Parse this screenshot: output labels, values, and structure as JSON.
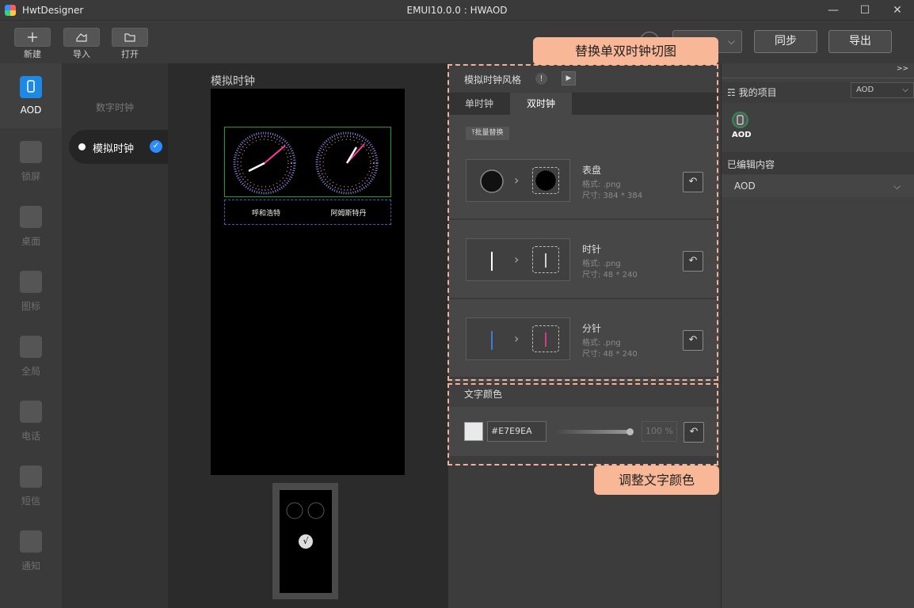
{
  "window": {
    "app_name": "HwtDesigner",
    "title": "EMUI10.0.0 : HWAOD",
    "minimize": "—",
    "maximize": "☐",
    "close": "✕"
  },
  "toolbar": {
    "new_label": "新建",
    "import_label": "导入",
    "open_label": "打开",
    "sync_label": "同步",
    "export_label": "导出",
    "version_value": ""
  },
  "leftnav": {
    "items": [
      {
        "label": "AOD",
        "icon": "phone-icon"
      },
      {
        "label": "锁屏",
        "icon": "lock-screen-icon"
      },
      {
        "label": "桌面",
        "icon": "desktop-icon"
      },
      {
        "label": "图标",
        "icon": "grid-icon"
      },
      {
        "label": "全局",
        "icon": "gear-icon"
      },
      {
        "label": "电话",
        "icon": "phone-call-icon"
      },
      {
        "label": "短信",
        "icon": "message-icon"
      },
      {
        "label": "通知",
        "icon": "notification-icon"
      }
    ]
  },
  "subnav": {
    "digital": "数字时钟",
    "analog": "模拟时钟",
    "check": "✓"
  },
  "canvas": {
    "title": "模拟时钟",
    "city_left": "呼和浩特",
    "city_right": "阿姆斯特丹",
    "thumb_check": "√"
  },
  "props": {
    "style_title": "模拟时钟风格",
    "info": "!",
    "play": "▶",
    "tab_single": "单时钟",
    "tab_double": "双时钟",
    "batch_replace": "批量替换",
    "cards": [
      {
        "name": "表盘",
        "format": "格式: .png",
        "size": "尺寸: 384 * 384"
      },
      {
        "name": "时针",
        "format": "格式: .png",
        "size": "尺寸: 48 * 240"
      },
      {
        "name": "分针",
        "format": "格式: .png",
        "size": "尺寸: 48 * 240"
      }
    ],
    "undo": "↶",
    "text_color_title": "文字颜色",
    "color_value": "#E7E9EA",
    "opacity_value": "100 %"
  },
  "callouts": {
    "top": "替换单双时钟切图",
    "bottom": "调整文字颜色"
  },
  "right": {
    "collapse": ">>",
    "project_title": "☶ 我的项目",
    "project_select": "AOD",
    "project_chevron": "⌵",
    "project_item": "AOD",
    "edited_title": "已编辑内容",
    "edited_item": "AOD",
    "edited_chevron": "⌵"
  },
  "colors": {
    "accent": "#1e88e5",
    "callout": "#f8b796",
    "text_color": "#E7E9EA"
  }
}
